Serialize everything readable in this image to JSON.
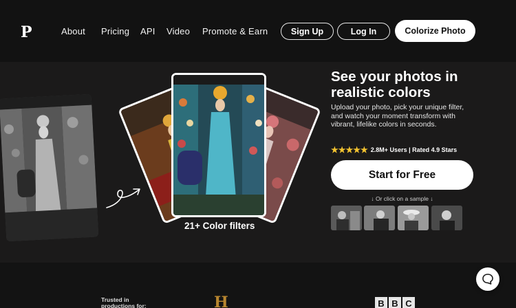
{
  "nav": {
    "logo": "P",
    "links": [
      "About",
      "Pricing",
      "API",
      "Video",
      "Promote & Earn"
    ],
    "sign_up": "Sign Up",
    "log_in": "Log In",
    "colorize": "Colorize Photo"
  },
  "hero": {
    "headline": "See your photos in realistic colors",
    "subtext": "Upload your photo, pick your unique filter, and watch your moment transform with vibrant, lifelike colors in seconds.",
    "stars": "★★★★★",
    "rating": "2.8M+ Users | Rated 4.9 Stars",
    "cta": "Start for Free",
    "sample_label": "↓ Or click on a sample ↓",
    "filters_caption": "21+ Color filters"
  },
  "trusted": {
    "label": "Trusted in productions for:",
    "history_logo": "H",
    "bbc_letters": [
      "B",
      "B",
      "C"
    ]
  }
}
